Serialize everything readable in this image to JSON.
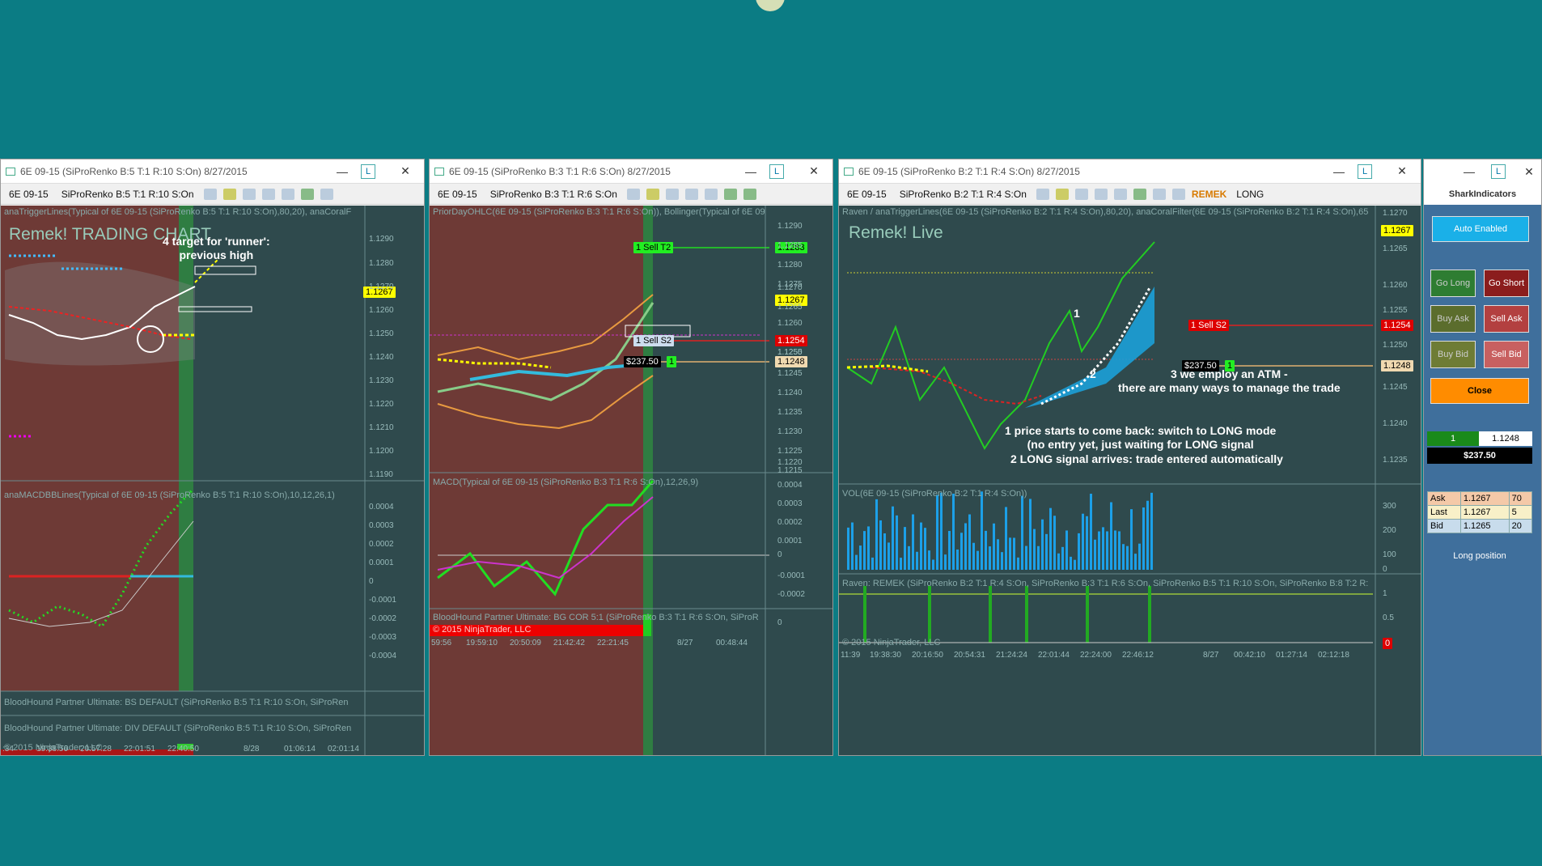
{
  "windows": [
    {
      "title": "6E 09-15 (SiProRenko B:5 T:1 R:10 S:On)  8/27/2015",
      "instrument": "6E 09-15",
      "bar_type": "SiProRenko B:5 T:1 R:10 S:On",
      "indicators": [
        "anaTriggerLines(Typical of 6E 09-15 (SiProRenko B:5 T:1 R:10 S:On),80,20), anaCoralF",
        "anaMACDBBLines(Typical of 6E 09-15 (SiProRenko B:5 T:1 R:10 S:On),10,12,26,1)",
        "BloodHound Partner Ultimate: BS  DEFAULT (SiProRenko B:5 T:1 R:10 S:On, SiProRen",
        "BloodHound Partner Ultimate: DIV  DEFAULT (SiProRenko B:5 T:1 R:10 S:On, SiProRen",
        "© 2015 NinjaTrader, LLC"
      ],
      "big_label": "Remek! TRADING CHART",
      "annotation": "4 target for 'runner':\nprevious high",
      "price_ticks": [
        "1.1290",
        "1.1280",
        "1.1270",
        "1.1260",
        "1.1250",
        "1.1240",
        "1.1230",
        "1.1220",
        "1.1210",
        "1.1200",
        "1.1190"
      ],
      "macd_ticks": [
        "0.0004",
        "0.0003",
        "0.0002",
        "0.0001",
        "0",
        "-0.0001",
        "-0.0002",
        "-0.0003",
        "-0.0004"
      ],
      "time_ticks": [
        ":34",
        "19:38:56",
        "20:57:28",
        "22:01:51",
        "22:40:50",
        "8/28",
        "01:06:14",
        "02:01:14"
      ],
      "price_tag": "1.1267"
    },
    {
      "title": "6E 09-15 (SiProRenko B:3 T:1 R:6 S:On)  8/27/2015",
      "instrument": "6E 09-15",
      "bar_type": "SiProRenko B:3 T:1 R:6 S:On",
      "indicators": [
        "PriorDayOHLC(6E 09-15 (SiProRenko B:3 T:1 R:6 S:On)), Bollinger(Typical of 6E 09",
        "MACD(Typical of 6E 09-15 (SiProRenko B:3 T:1 R:6 S:On),12,26,9)",
        "BloodHound Partner Ultimate: BG  COR 5:1 (SiProRenko B:3 T:1 R:6 S:On, SiProR",
        "© 2015 NinjaTrader, LLC"
      ],
      "sell_t2": "1  Sell T2",
      "sell_s2": "1  Sell S2",
      "pnl": "$237.50",
      "pnl_qty": "1",
      "tags": [
        "1.1283",
        "1.1267",
        "1.1254",
        "1.1248"
      ],
      "price_ticks": [
        "1.1290",
        "1.1285",
        "1.1280",
        "1.1275",
        "1.1270",
        "1.1265",
        "1.1260",
        "1.1255",
        "1.1250",
        "1.1245",
        "1.1240",
        "1.1235",
        "1.1230",
        "1.1225",
        "1.1220",
        "1.1215"
      ],
      "macd_ticks": [
        "0.0004",
        "0.0003",
        "0.0002",
        "0.0001",
        "0",
        "-0.0001",
        "-0.0002"
      ],
      "bh_tick": "0",
      "time_ticks": [
        "59:56",
        "19:59:10",
        "20:50:09",
        "21:42:42",
        "22:21:45",
        "8/27",
        "00:48:44"
      ]
    },
    {
      "title": "6E 09-15 (SiProRenko B:2 T:1 R:4 S:On)  8/27/2015",
      "instrument": "6E 09-15",
      "bar_type": "SiProRenko B:2 T:1 R:4 S:On",
      "remek": "REMEK",
      "mode": "LONG",
      "indicators": [
        "Raven / anaTriggerLines(6E 09-15 (SiProRenko B:2 T:1 R:4 S:On),80,20), anaCoralFilter(6E 09-15 (SiProRenko B:2 T:1 R:4 S:On),65",
        "VOL(6E 09-15 (SiProRenko B:2 T:1 R:4 S:On))",
        "Raven: REMEK (SiProRenko B:2 T:1 R:4 S:On, SiProRenko B:3 T:1 R:6 S:On, SiProRenko B:5 T:1 R:10 S:On, SiProRenko B:8 T:2 R:",
        "© 2015 NinjaTrader, LLC"
      ],
      "big_label": "Remek! Live",
      "sell_s2": "1  Sell S2",
      "pnl": "$237.50",
      "pnl_qty": "1",
      "tags": [
        "1.1267",
        "1.1254",
        "1.1248"
      ],
      "marker_1": "1",
      "marker_2": "2",
      "annotation_3": "3 we employ an ATM -\nthere are many ways to manage the trade",
      "annotation_1": "1 price starts to come back: switch to LONG mode\n(no entry yet, just waiting for LONG signal",
      "annotation_2": "2 LONG signal arrives: trade entered automatically",
      "price_ticks": [
        "1.1270",
        "1.1265",
        "1.1260",
        "1.1255",
        "1.1250",
        "1.1245",
        "1.1240",
        "1.1235"
      ],
      "vol_ticks": [
        "300",
        "200",
        "100",
        "0"
      ],
      "raven_ticks": [
        "1",
        "0.5",
        "0"
      ],
      "time_ticks": [
        "11:39",
        "19:38:30",
        "20:16:50",
        "20:54:31",
        "21:24:24",
        "22:01:44",
        "22:24:00",
        "22:46:12",
        "8/27",
        "00:42:10",
        "01:27:14",
        "02:12:18"
      ]
    }
  ],
  "order_panel": {
    "logo": "SharkIndicators",
    "auto_enabled": "Auto Enabled",
    "go_long": "Go Long",
    "go_short": "Go Short",
    "buy_ask": "Buy Ask",
    "sell_ask": "Sell Ask",
    "buy_bid": "Buy Bid",
    "sell_bid": "Sell Bid",
    "close": "Close",
    "position_qty": "1",
    "position_price": "1.1248",
    "position_pnl": "$237.50",
    "quotes": [
      {
        "label": "Ask",
        "price": "1.1267",
        "size": "70"
      },
      {
        "label": "Last",
        "price": "1.1267",
        "size": "5"
      },
      {
        "label": "Bid",
        "price": "1.1265",
        "size": "20"
      }
    ],
    "status": "Long position"
  },
  "window_controls": {
    "minimize": "—",
    "close": "✕",
    "layout": "L"
  },
  "colors": {
    "background": "#0b7c84",
    "chart_bg": "#2f4a4d",
    "sell_red": "#c62828",
    "buy_green": "#2e7d32",
    "close_orange": "#ff8c00",
    "auto_cyan": "#1ab0e8"
  }
}
